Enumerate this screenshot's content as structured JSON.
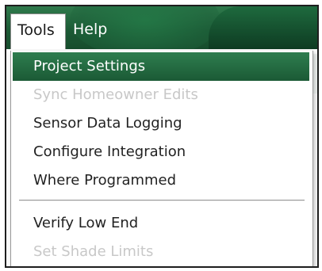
{
  "menubar": {
    "menus": [
      {
        "label": "Tools",
        "active": true
      },
      {
        "label": "Help",
        "active": false
      }
    ]
  },
  "tools_menu": {
    "items": [
      {
        "label": "Project Settings",
        "state": "highlighted"
      },
      {
        "label": "Sync Homeowner Edits",
        "state": "disabled"
      },
      {
        "label": "Sensor Data Logging",
        "state": "enabled"
      },
      {
        "label": "Configure Integration",
        "state": "enabled"
      },
      {
        "label": "Where Programmed",
        "state": "enabled"
      },
      {
        "label": "Verify Low End",
        "state": "enabled"
      },
      {
        "label": "Set Shade Limits",
        "state": "disabled"
      }
    ]
  },
  "colors": {
    "menubar_green": "#1c5a35",
    "highlight_green": "#2e7d4f",
    "disabled_text": "#c8c8c8"
  }
}
